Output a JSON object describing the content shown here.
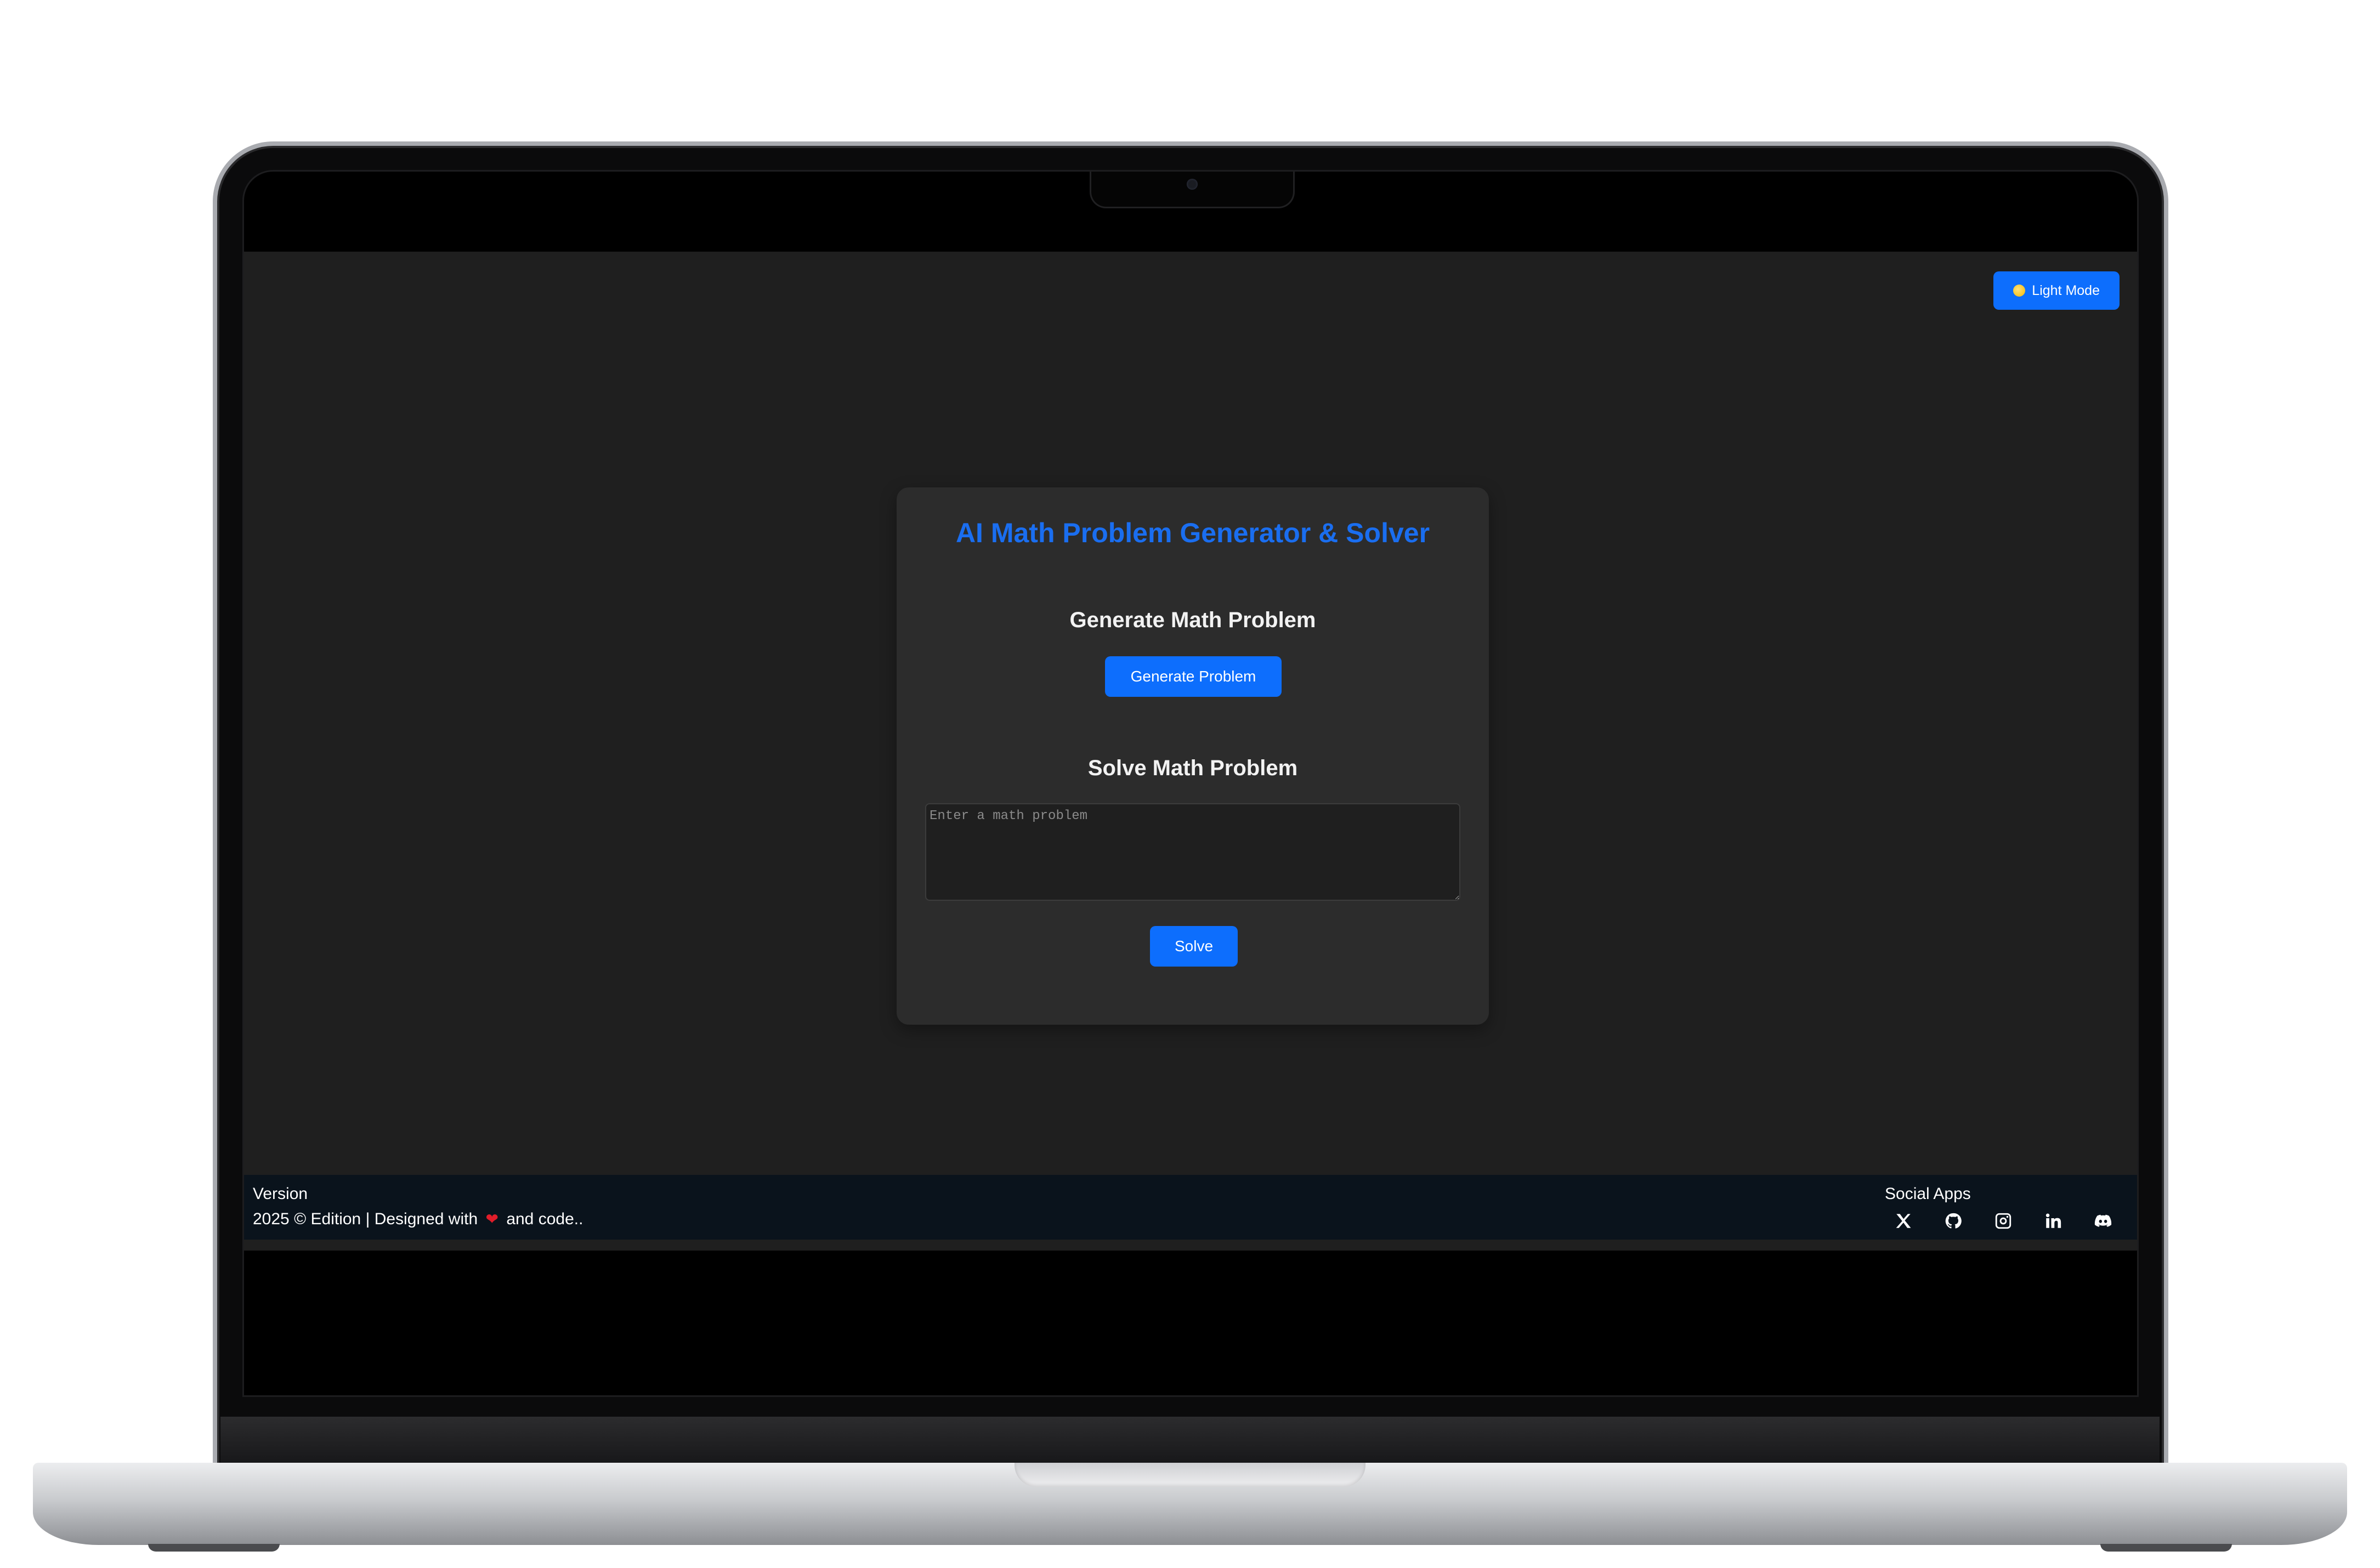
{
  "theme_toggle": {
    "label": "Light Mode",
    "icon": "sun-icon"
  },
  "card": {
    "title": "AI Math Problem Generator & Solver",
    "generate_heading": "Generate Math Problem",
    "generate_button": "Generate Problem",
    "solve_heading": "Solve Math Problem",
    "problem_input": {
      "placeholder": "Enter a math problem",
      "value": ""
    },
    "solve_button": "Solve"
  },
  "footer": {
    "version_label": "Version",
    "edition_prefix": "2025 © Edition | Designed with",
    "edition_suffix": "and code..",
    "heart_icon": "heart-icon",
    "social_title": "Social Apps",
    "social_icons": [
      "x-icon",
      "github-icon",
      "instagram-icon",
      "linkedin-icon",
      "discord-icon"
    ]
  },
  "colors": {
    "accent": "#0d6efd",
    "title": "#1a6ef0",
    "background": "#1f1f1f",
    "card": "#2c2c2c",
    "footer": "#0a131c",
    "heart": "#e11d2a"
  }
}
